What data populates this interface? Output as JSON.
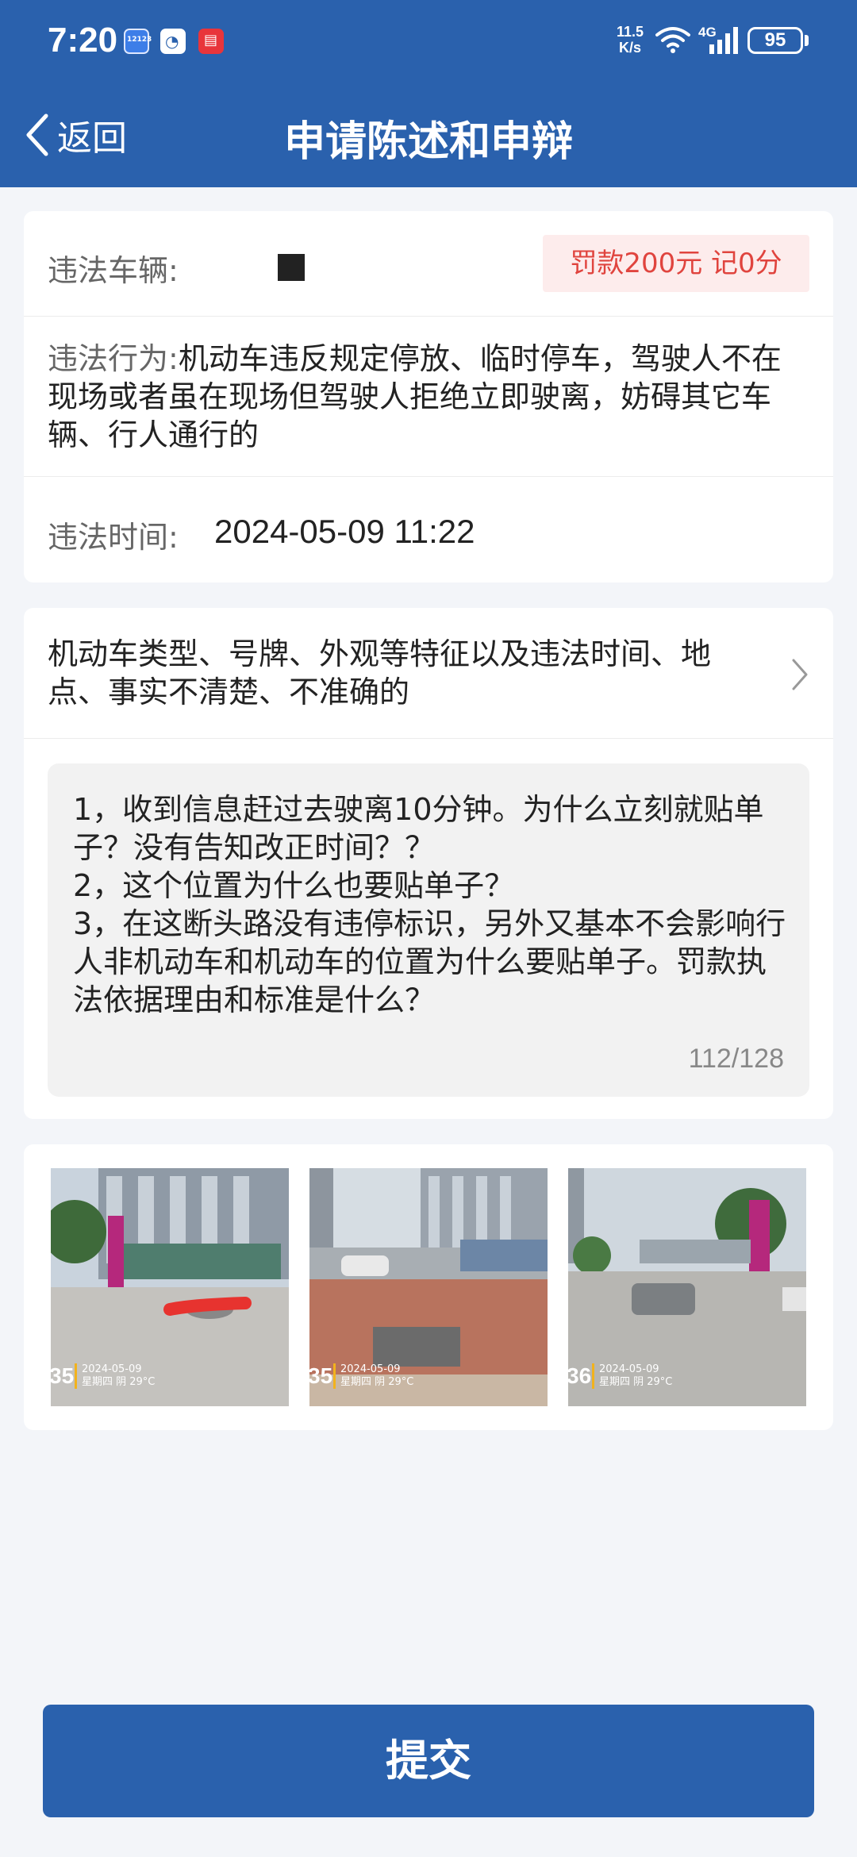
{
  "status_bar": {
    "time": "7:20",
    "app_icon_1": "12123",
    "net_speed_value": "11.5",
    "net_speed_unit": "K/s",
    "network_type": "4G",
    "battery": "95"
  },
  "nav": {
    "back_label": "返回",
    "title": "申请陈述和申辩"
  },
  "violation": {
    "vehicle_label": "违法车辆:",
    "fine_badge": "罚款200元 记0分",
    "behavior_label": "违法行为:",
    "behavior_value": "机动车违反规定停放、临时停车，驾驶人不在现场或者虽在现场但驾驶人拒绝立即驶离，妨碍其它车辆、行人通行的",
    "time_label": "违法时间:",
    "time_value": "2024-05-09 11:22"
  },
  "appeal": {
    "reason": "机动车类型、号牌、外观等特征以及违法时间、地点、事实不清楚、不准确的",
    "statement": "1，收到信息赶过去驶离10分钟。为什么立刻就贴单子？没有告知改正时间？？\n2，这个位置为什么也要贴单子？\n3，在这断头路没有违停标识，另外又基本不会影响行人非机动车和机动车的位置为什么要贴单子。罚款执法依据理由和标准是什么？",
    "char_count": "112/128"
  },
  "photos": [
    {
      "num": "35",
      "date": "2024-05-09",
      "weather": "星期四 阴 29°C"
    },
    {
      "num": "35",
      "date": "2024-05-09",
      "weather": "星期四 阴 29°C"
    },
    {
      "num": "36",
      "date": "2024-05-09",
      "weather": "星期四 阴 29°C"
    }
  ],
  "submit_label": "提交",
  "colors": {
    "primary": "#2a61ad",
    "fine_text": "#e0443e",
    "fine_bg": "#fdecec",
    "page_bg": "#f3f5f9"
  }
}
